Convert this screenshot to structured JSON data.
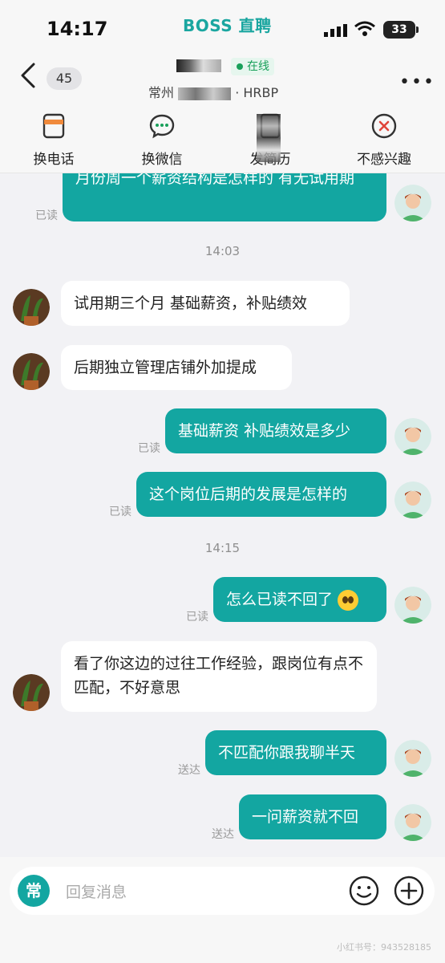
{
  "status": {
    "time": "14:17",
    "app_name": "BOSS 直聘",
    "battery": "33"
  },
  "header": {
    "unread_count": "45",
    "online_label": "在线",
    "company_prefix": "常州",
    "company_suffix": "· HRBP"
  },
  "actions": [
    {
      "label": "换电话",
      "icon": "phone-card-icon"
    },
    {
      "label": "换微信",
      "icon": "wechat-icon"
    },
    {
      "label": "发简历",
      "icon": "resume-icon"
    },
    {
      "label": "不感兴趣",
      "icon": "not-interested-icon"
    }
  ],
  "messages": [
    {
      "text": "月份周一个薪资结构是怎样的 有无试用期",
      "dir": "out",
      "status": "已读"
    },
    {
      "timestamp": "14:03"
    },
    {
      "text": "试用期三个月 基础薪资，补贴绩效",
      "dir": "in"
    },
    {
      "text": "后期独立管理店铺外加提成",
      "dir": "in"
    },
    {
      "text": "基础薪资 补贴绩效是多少",
      "dir": "out",
      "status": "已读"
    },
    {
      "text": "这个岗位后期的发展是怎样的",
      "dir": "out",
      "status": "已读"
    },
    {
      "timestamp": "14:15"
    },
    {
      "text": "怎么已读不回了",
      "dir": "out",
      "status": "已读",
      "emoji": "pleading-face"
    },
    {
      "text": "看了你这边的过往工作经验，跟岗位有点不匹配，不好意思",
      "dir": "in"
    },
    {
      "text": "不匹配你跟我聊半天",
      "dir": "out",
      "status": "送达"
    },
    {
      "text": "一问薪资就不回",
      "dir": "out",
      "status": "送达"
    }
  ],
  "input": {
    "quick_label": "常",
    "placeholder": "回复消息"
  },
  "watermark": "小红书号：943528185",
  "colors": {
    "accent": "#13a6a1",
    "online": "#19a05a"
  }
}
